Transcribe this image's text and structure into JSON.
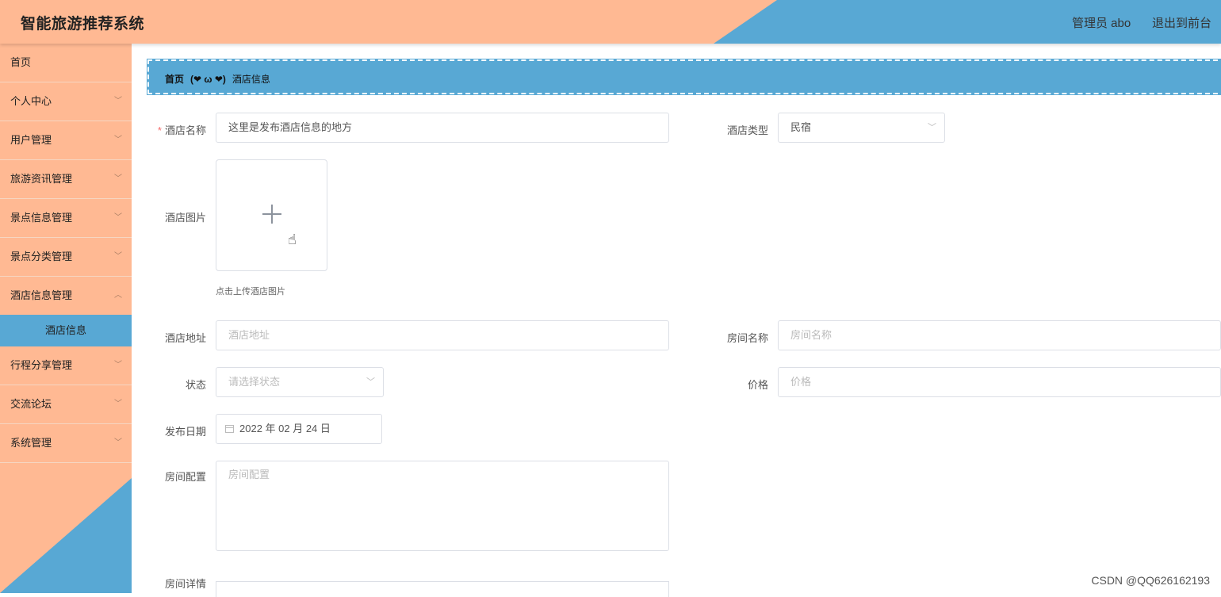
{
  "header": {
    "title": "智能旅游推荐系统",
    "user": "管理员 abo",
    "logout": "退出到前台"
  },
  "sidebar": {
    "items": [
      {
        "label": "首页"
      },
      {
        "label": "个人中心"
      },
      {
        "label": "用户管理"
      },
      {
        "label": "旅游资讯管理"
      },
      {
        "label": "景点信息管理"
      },
      {
        "label": "景点分类管理"
      },
      {
        "label": "酒店信息管理"
      },
      {
        "label": "行程分享管理"
      },
      {
        "label": "交流论坛"
      },
      {
        "label": "系统管理"
      }
    ],
    "active_sub": "酒店信息"
  },
  "breadcrumb": {
    "home": "首页",
    "separator": "(❤ ω ❤)",
    "current": "酒店信息"
  },
  "form": {
    "hotel_name_label": "酒店名称",
    "hotel_name_value": "这里是发布酒店信息的地方",
    "hotel_type_label": "酒店类型",
    "hotel_type_value": "民宿",
    "hotel_image_label": "酒店图片",
    "upload_hint": "点击上传酒店图片",
    "address_label": "酒店地址",
    "address_placeholder": "酒店地址",
    "room_name_label": "房间名称",
    "room_name_placeholder": "房间名称",
    "status_label": "状态",
    "status_placeholder": "请选择状态",
    "price_label": "价格",
    "price_placeholder": "价格",
    "date_label": "发布日期",
    "date_value": "2022 年 02 月 24 日",
    "room_config_label": "房间配置",
    "room_config_placeholder": "房间配置",
    "room_detail_label": "房间详情"
  },
  "watermark": "CSDN @QQ626162193",
  "colors": {
    "accent_orange": "#ffb993",
    "accent_blue": "#58a8d4"
  }
}
